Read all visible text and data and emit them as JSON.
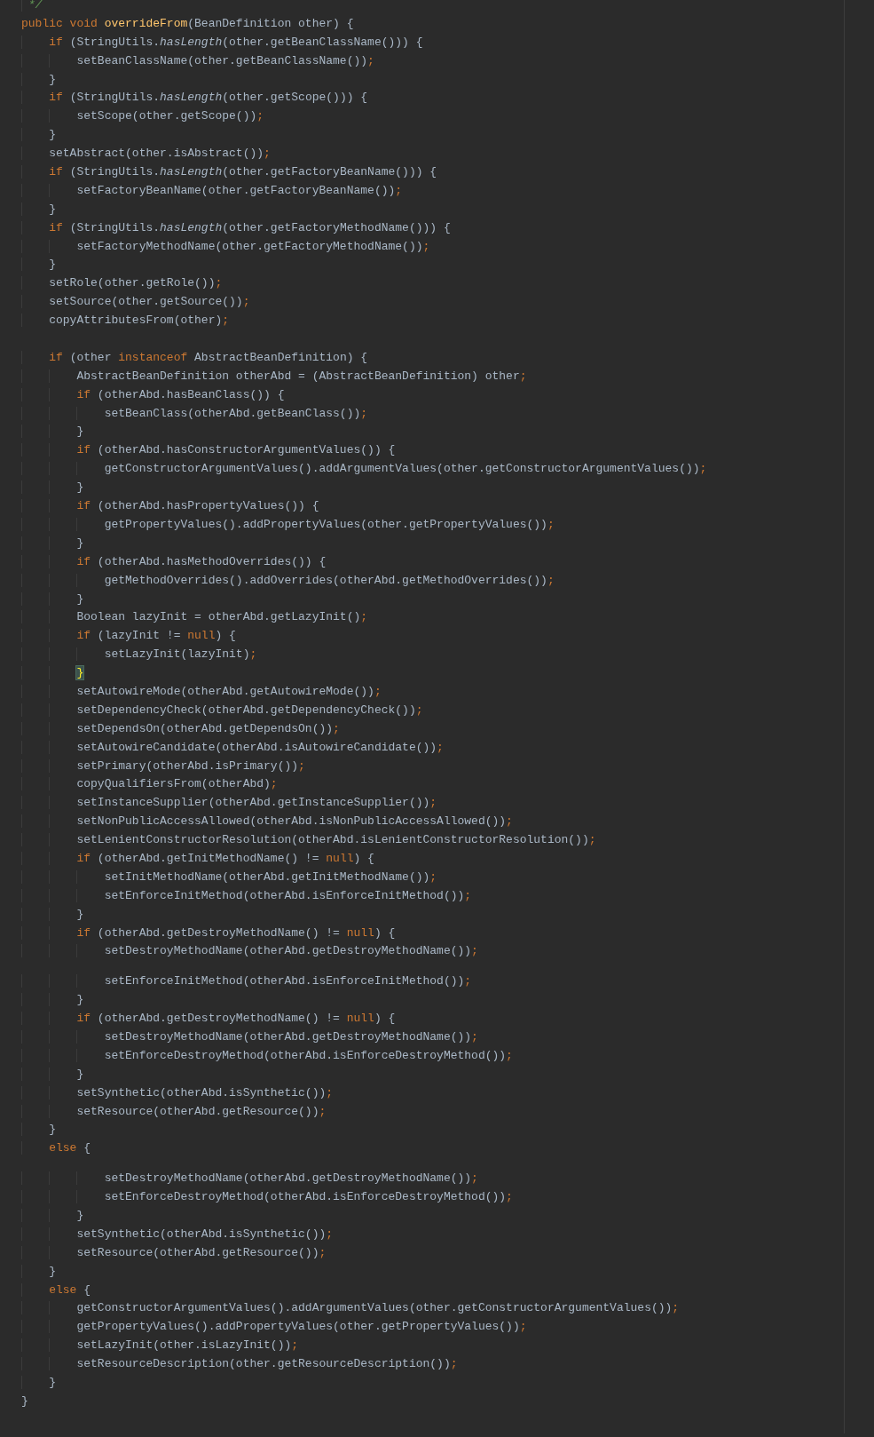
{
  "editor": {
    "lines": [
      {
        "kind": "code",
        "tokens": [
          {
            "kind": "comment",
            "text": " */"
          }
        ]
      },
      {
        "kind": "code",
        "tokens": [
          {
            "kind": "keyword",
            "text": "public void "
          },
          {
            "kind": "decl",
            "text": "overrideFrom"
          },
          {
            "kind": "plain",
            "text": "(BeanDefinition other) {"
          }
        ]
      },
      {
        "kind": "code",
        "tokens": [
          {
            "kind": "keyword",
            "text": "    if "
          },
          {
            "kind": "plain",
            "text": "(StringUtils."
          },
          {
            "kind": "static",
            "text": "hasLength"
          },
          {
            "kind": "plain",
            "text": "(other.getBeanClassName())) {"
          }
        ]
      },
      {
        "kind": "code",
        "tokens": [
          {
            "kind": "plain",
            "text": "        setBeanClassName(other.getBeanClassName())"
          },
          {
            "kind": "punct",
            "text": ";"
          }
        ]
      },
      {
        "kind": "code",
        "tokens": [
          {
            "kind": "plain",
            "text": "    }"
          }
        ]
      },
      {
        "kind": "code",
        "tokens": [
          {
            "kind": "keyword",
            "text": "    if "
          },
          {
            "kind": "plain",
            "text": "(StringUtils."
          },
          {
            "kind": "static",
            "text": "hasLength"
          },
          {
            "kind": "plain",
            "text": "(other.getScope())) {"
          }
        ]
      },
      {
        "kind": "code",
        "tokens": [
          {
            "kind": "plain",
            "text": "        setScope(other.getScope())"
          },
          {
            "kind": "punct",
            "text": ";"
          }
        ]
      },
      {
        "kind": "code",
        "tokens": [
          {
            "kind": "plain",
            "text": "    }"
          }
        ]
      },
      {
        "kind": "code",
        "tokens": [
          {
            "kind": "plain",
            "text": "    setAbstract(other.isAbstract())"
          },
          {
            "kind": "punct",
            "text": ";"
          }
        ]
      },
      {
        "kind": "code",
        "tokens": [
          {
            "kind": "keyword",
            "text": "    if "
          },
          {
            "kind": "plain",
            "text": "(StringUtils."
          },
          {
            "kind": "static",
            "text": "hasLength"
          },
          {
            "kind": "plain",
            "text": "(other.getFactoryBeanName())) {"
          }
        ]
      },
      {
        "kind": "code",
        "tokens": [
          {
            "kind": "plain",
            "text": "        setFactoryBeanName(other.getFactoryBeanName())"
          },
          {
            "kind": "punct",
            "text": ";"
          }
        ]
      },
      {
        "kind": "code",
        "tokens": [
          {
            "kind": "plain",
            "text": "    }"
          }
        ]
      },
      {
        "kind": "code",
        "tokens": [
          {
            "kind": "keyword",
            "text": "    if "
          },
          {
            "kind": "plain",
            "text": "(StringUtils."
          },
          {
            "kind": "static",
            "text": "hasLength"
          },
          {
            "kind": "plain",
            "text": "(other.getFactoryMethodName())) {"
          }
        ]
      },
      {
        "kind": "code",
        "tokens": [
          {
            "kind": "plain",
            "text": "        setFactoryMethodName(other.getFactoryMethodName())"
          },
          {
            "kind": "punct",
            "text": ";"
          }
        ]
      },
      {
        "kind": "code",
        "tokens": [
          {
            "kind": "plain",
            "text": "    }"
          }
        ]
      },
      {
        "kind": "code",
        "tokens": [
          {
            "kind": "plain",
            "text": "    setRole(other.getRole())"
          },
          {
            "kind": "punct",
            "text": ";"
          }
        ]
      },
      {
        "kind": "code",
        "tokens": [
          {
            "kind": "plain",
            "text": "    setSource(other.getSource())"
          },
          {
            "kind": "punct",
            "text": ";"
          }
        ]
      },
      {
        "kind": "code",
        "tokens": [
          {
            "kind": "plain",
            "text": "    copyAttributesFrom(other)"
          },
          {
            "kind": "punct",
            "text": ";"
          }
        ]
      },
      {
        "kind": "blank"
      },
      {
        "kind": "code",
        "tokens": [
          {
            "kind": "keyword",
            "text": "    if "
          },
          {
            "kind": "plain",
            "text": "(other "
          },
          {
            "kind": "keyword",
            "text": "instanceof "
          },
          {
            "kind": "plain",
            "text": "AbstractBeanDefinition) {"
          }
        ]
      },
      {
        "kind": "code",
        "tokens": [
          {
            "kind": "plain",
            "text": "        AbstractBeanDefinition otherAbd = (AbstractBeanDefinition) other"
          },
          {
            "kind": "punct",
            "text": ";"
          }
        ]
      },
      {
        "kind": "code",
        "tokens": [
          {
            "kind": "keyword",
            "text": "        if "
          },
          {
            "kind": "plain",
            "text": "(otherAbd.hasBeanClass()) {"
          }
        ]
      },
      {
        "kind": "code",
        "tokens": [
          {
            "kind": "plain",
            "text": "            setBeanClass(otherAbd.getBeanClass())"
          },
          {
            "kind": "punct",
            "text": ";"
          }
        ]
      },
      {
        "kind": "code",
        "tokens": [
          {
            "kind": "plain",
            "text": "        }"
          }
        ]
      },
      {
        "kind": "code",
        "tokens": [
          {
            "kind": "keyword",
            "text": "        if "
          },
          {
            "kind": "plain",
            "text": "(otherAbd.hasConstructorArgumentValues()) {"
          }
        ]
      },
      {
        "kind": "code",
        "tokens": [
          {
            "kind": "plain",
            "text": "            getConstructorArgumentValues().addArgumentValues(other.getConstructorArgumentValues())"
          },
          {
            "kind": "punct",
            "text": ";"
          }
        ]
      },
      {
        "kind": "code",
        "tokens": [
          {
            "kind": "plain",
            "text": "        }"
          }
        ]
      },
      {
        "kind": "code",
        "tokens": [
          {
            "kind": "keyword",
            "text": "        if "
          },
          {
            "kind": "plain",
            "text": "(otherAbd.hasPropertyValues()) {"
          }
        ]
      },
      {
        "kind": "code",
        "tokens": [
          {
            "kind": "plain",
            "text": "            getPropertyValues().addPropertyValues(other.getPropertyValues())"
          },
          {
            "kind": "punct",
            "text": ";"
          }
        ]
      },
      {
        "kind": "code",
        "tokens": [
          {
            "kind": "plain",
            "text": "        }"
          }
        ]
      },
      {
        "kind": "code",
        "tokens": [
          {
            "kind": "keyword",
            "text": "        if "
          },
          {
            "kind": "plain",
            "text": "(otherAbd.hasMethodOverrides()) {"
          }
        ]
      },
      {
        "kind": "code",
        "tokens": [
          {
            "kind": "plain",
            "text": "            getMethodOverrides().addOverrides(otherAbd.getMethodOverrides())"
          },
          {
            "kind": "punct",
            "text": ";"
          }
        ]
      },
      {
        "kind": "code",
        "tokens": [
          {
            "kind": "plain",
            "text": "        }"
          }
        ]
      },
      {
        "kind": "code",
        "tokens": [
          {
            "kind": "plain",
            "text": "        Boolean lazyInit = otherAbd.getLazyInit()"
          },
          {
            "kind": "punct",
            "text": ";"
          }
        ]
      },
      {
        "kind": "code",
        "tokens": [
          {
            "kind": "keyword",
            "text": "        if "
          },
          {
            "kind": "plain",
            "text": "(lazyInit != "
          },
          {
            "kind": "keyword",
            "text": "null"
          },
          {
            "kind": "plain",
            "text": ") {"
          }
        ]
      },
      {
        "kind": "code",
        "tokens": [
          {
            "kind": "plain",
            "text": "            setLazyInit(lazyInit)"
          },
          {
            "kind": "punct",
            "text": ";"
          }
        ]
      },
      {
        "kind": "code",
        "tokens": [
          {
            "kind": "match",
            "text": "        }"
          }
        ]
      },
      {
        "kind": "code",
        "tokens": [
          {
            "kind": "plain",
            "text": "        setAutowireMode(otherAbd.getAutowireMode())"
          },
          {
            "kind": "punct",
            "text": ";"
          }
        ]
      },
      {
        "kind": "code",
        "tokens": [
          {
            "kind": "plain",
            "text": "        setDependencyCheck(otherAbd.getDependencyCheck())"
          },
          {
            "kind": "punct",
            "text": ";"
          }
        ]
      },
      {
        "kind": "code",
        "tokens": [
          {
            "kind": "plain",
            "text": "        setDependsOn(otherAbd.getDependsOn())"
          },
          {
            "kind": "punct",
            "text": ";"
          }
        ]
      },
      {
        "kind": "code",
        "tokens": [
          {
            "kind": "plain",
            "text": "        setAutowireCandidate(otherAbd.isAutowireCandidate())"
          },
          {
            "kind": "punct",
            "text": ";"
          }
        ]
      },
      {
        "kind": "code",
        "tokens": [
          {
            "kind": "plain",
            "text": "        setPrimary(otherAbd.isPrimary())"
          },
          {
            "kind": "punct",
            "text": ";"
          }
        ]
      },
      {
        "kind": "code",
        "tokens": [
          {
            "kind": "plain",
            "text": "        copyQualifiersFrom(otherAbd)"
          },
          {
            "kind": "punct",
            "text": ";"
          }
        ]
      },
      {
        "kind": "code",
        "tokens": [
          {
            "kind": "plain",
            "text": "        setInstanceSupplier(otherAbd.getInstanceSupplier())"
          },
          {
            "kind": "punct",
            "text": ";"
          }
        ]
      },
      {
        "kind": "code",
        "tokens": [
          {
            "kind": "plain",
            "text": "        setNonPublicAccessAllowed(otherAbd.isNonPublicAccessAllowed())"
          },
          {
            "kind": "punct",
            "text": ";"
          }
        ]
      },
      {
        "kind": "code",
        "tokens": [
          {
            "kind": "plain",
            "text": "        setLenientConstructorResolution(otherAbd.isLenientConstructorResolution())"
          },
          {
            "kind": "punct",
            "text": ";"
          }
        ]
      },
      {
        "kind": "code",
        "tokens": [
          {
            "kind": "keyword",
            "text": "        if "
          },
          {
            "kind": "plain",
            "text": "(otherAbd.getInitMethodName() != "
          },
          {
            "kind": "keyword",
            "text": "null"
          },
          {
            "kind": "plain",
            "text": ") {"
          }
        ]
      },
      {
        "kind": "code",
        "tokens": [
          {
            "kind": "plain",
            "text": "            setInitMethodName(otherAbd.getInitMethodName())"
          },
          {
            "kind": "punct",
            "text": ";"
          }
        ]
      },
      {
        "kind": "code",
        "tokens": [
          {
            "kind": "plain",
            "text": "            setEnforceInitMethod(otherAbd.isEnforceInitMethod())"
          },
          {
            "kind": "punct",
            "text": ";"
          }
        ]
      },
      {
        "kind": "code",
        "tokens": [
          {
            "kind": "plain",
            "text": "        }"
          }
        ]
      },
      {
        "kind": "code",
        "tokens": [
          {
            "kind": "keyword",
            "text": "        if "
          },
          {
            "kind": "plain",
            "text": "(otherAbd.getDestroyMethodName() != "
          },
          {
            "kind": "keyword",
            "text": "null"
          },
          {
            "kind": "plain",
            "text": ") {"
          }
        ]
      },
      {
        "kind": "code",
        "tokens": [
          {
            "kind": "plain",
            "text": "            setDestroyMethodName(otherAbd.getDestroyMethodName())"
          },
          {
            "kind": "punct",
            "text": ";"
          }
        ]
      },
      {
        "kind": "cut"
      },
      {
        "kind": "code",
        "tokens": [
          {
            "kind": "plain",
            "text": "            setEnforceInitMethod(otherAbd.isEnforceInitMethod())"
          },
          {
            "kind": "punct",
            "text": ";"
          }
        ]
      },
      {
        "kind": "code",
        "tokens": [
          {
            "kind": "plain",
            "text": "        }"
          }
        ]
      },
      {
        "kind": "code",
        "tokens": [
          {
            "kind": "keyword",
            "text": "        if "
          },
          {
            "kind": "plain",
            "text": "(otherAbd.getDestroyMethodName() != "
          },
          {
            "kind": "keyword",
            "text": "null"
          },
          {
            "kind": "plain",
            "text": ") {"
          }
        ]
      },
      {
        "kind": "code",
        "tokens": [
          {
            "kind": "plain",
            "text": "            setDestroyMethodName(otherAbd.getDestroyMethodName())"
          },
          {
            "kind": "punct",
            "text": ";"
          }
        ]
      },
      {
        "kind": "code",
        "tokens": [
          {
            "kind": "plain",
            "text": "            setEnforceDestroyMethod(otherAbd.isEnforceDestroyMethod())"
          },
          {
            "kind": "punct",
            "text": ";"
          }
        ]
      },
      {
        "kind": "code",
        "tokens": [
          {
            "kind": "plain",
            "text": "        }"
          }
        ]
      },
      {
        "kind": "code",
        "tokens": [
          {
            "kind": "plain",
            "text": "        setSynthetic(otherAbd.isSynthetic())"
          },
          {
            "kind": "punct",
            "text": ";"
          }
        ]
      },
      {
        "kind": "code",
        "tokens": [
          {
            "kind": "plain",
            "text": "        setResource(otherAbd.getResource())"
          },
          {
            "kind": "punct",
            "text": ";"
          }
        ]
      },
      {
        "kind": "code",
        "tokens": [
          {
            "kind": "plain",
            "text": "    }"
          }
        ]
      },
      {
        "kind": "code",
        "tokens": [
          {
            "kind": "keyword",
            "text": "    else "
          },
          {
            "kind": "plain",
            "text": "{"
          }
        ]
      },
      {
        "kind": "cut"
      },
      {
        "kind": "code",
        "tokens": [
          {
            "kind": "plain",
            "text": "            setDestroyMethodName(otherAbd.getDestroyMethodName())"
          },
          {
            "kind": "punct",
            "text": ";"
          }
        ]
      },
      {
        "kind": "code",
        "tokens": [
          {
            "kind": "plain",
            "text": "            setEnforceDestroyMethod(otherAbd.isEnforceDestroyMethod())"
          },
          {
            "kind": "punct",
            "text": ";"
          }
        ]
      },
      {
        "kind": "code",
        "tokens": [
          {
            "kind": "plain",
            "text": "        }"
          }
        ]
      },
      {
        "kind": "code",
        "tokens": [
          {
            "kind": "plain",
            "text": "        setSynthetic(otherAbd.isSynthetic())"
          },
          {
            "kind": "punct",
            "text": ";"
          }
        ]
      },
      {
        "kind": "code",
        "tokens": [
          {
            "kind": "plain",
            "text": "        setResource(otherAbd.getResource())"
          },
          {
            "kind": "punct",
            "text": ";"
          }
        ]
      },
      {
        "kind": "code",
        "tokens": [
          {
            "kind": "plain",
            "text": "    }"
          }
        ]
      },
      {
        "kind": "code",
        "tokens": [
          {
            "kind": "keyword",
            "text": "    else "
          },
          {
            "kind": "plain",
            "text": "{"
          }
        ]
      },
      {
        "kind": "code",
        "tokens": [
          {
            "kind": "plain",
            "text": "        getConstructorArgumentValues().addArgumentValues(other.getConstructorArgumentValues())"
          },
          {
            "kind": "punct",
            "text": ";"
          }
        ]
      },
      {
        "kind": "code",
        "tokens": [
          {
            "kind": "plain",
            "text": "        getPropertyValues().addPropertyValues(other.getPropertyValues())"
          },
          {
            "kind": "punct",
            "text": ";"
          }
        ]
      },
      {
        "kind": "code",
        "tokens": [
          {
            "kind": "plain",
            "text": "        setLazyInit(other.isLazyInit())"
          },
          {
            "kind": "punct",
            "text": ";"
          }
        ]
      },
      {
        "kind": "code",
        "tokens": [
          {
            "kind": "plain",
            "text": "        setResourceDescription(other.getResourceDescription())"
          },
          {
            "kind": "punct",
            "text": ";"
          }
        ]
      },
      {
        "kind": "code",
        "tokens": [
          {
            "kind": "plain",
            "text": "    }"
          }
        ]
      },
      {
        "kind": "code",
        "tokens": [
          {
            "kind": "plain",
            "text": "}"
          }
        ]
      }
    ]
  }
}
